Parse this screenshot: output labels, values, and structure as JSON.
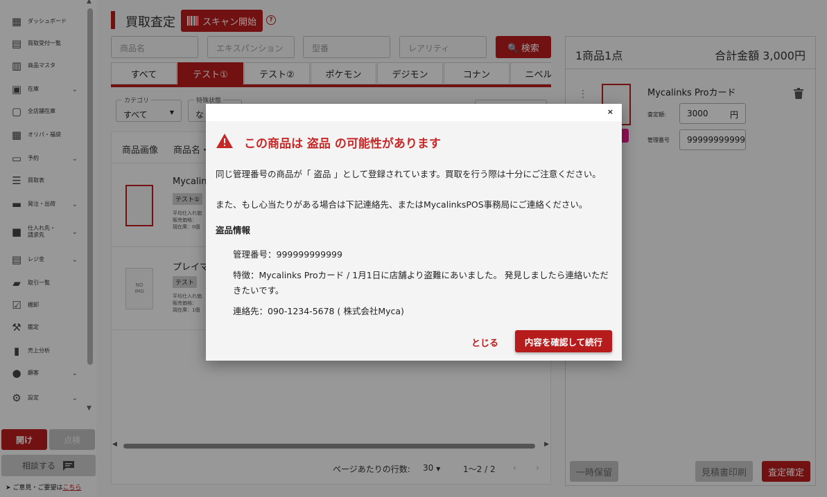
{
  "sidebar": {
    "items": [
      {
        "label": "ダッシュボード",
        "icon": "dashboard-icon",
        "has_children": false
      },
      {
        "label": "買取受付一覧",
        "icon": "receipt-icon",
        "has_children": false
      },
      {
        "label": "商品マスタ",
        "icon": "store-icon",
        "has_children": false
      },
      {
        "label": "在庫",
        "icon": "inventory-icon",
        "has_children": true
      },
      {
        "label": "全店舗在庫",
        "icon": "archive-icon",
        "has_children": false
      },
      {
        "label": "オリパ・福袋",
        "icon": "gift-icon",
        "has_children": false
      },
      {
        "label": "予約",
        "icon": "reserve-icon",
        "has_children": true
      },
      {
        "label": "買取表",
        "icon": "list-icon",
        "has_children": false
      },
      {
        "label": "発注・出荷",
        "icon": "truck-icon",
        "has_children": true
      },
      {
        "label": "仕入れ先・\n請求先",
        "icon": "factory-icon",
        "has_children": true
      },
      {
        "label": "レジ金",
        "icon": "register-icon",
        "has_children": true
      },
      {
        "label": "取引一覧",
        "icon": "folder-icon",
        "has_children": false
      },
      {
        "label": "棚卸",
        "icon": "checkbox-icon",
        "has_children": false
      },
      {
        "label": "鑑定",
        "icon": "gavel-icon",
        "has_children": false
      },
      {
        "label": "売上分析",
        "icon": "chart-icon",
        "has_children": false
      },
      {
        "label": "顧客",
        "icon": "people-icon",
        "has_children": true
      },
      {
        "label": "設定",
        "icon": "gear-icon",
        "has_children": true
      }
    ],
    "open_label": "開け",
    "check_label": "点検",
    "consult_label": "相談する",
    "feedback_text": "ご意見・ご要望は",
    "feedback_link": "こちら"
  },
  "header": {
    "title": "買取査定",
    "scan_label": "スキャン開始",
    "help": "?"
  },
  "search": {
    "name_placeholder": "商品名",
    "expansion_placeholder": "エキスパンション",
    "model_placeholder": "型番",
    "rarity_placeholder": "レアリティ",
    "button_label": "検索"
  },
  "tabs": [
    {
      "label": "すべて",
      "active": false
    },
    {
      "label": "テスト①",
      "active": true
    },
    {
      "label": "テスト②",
      "active": false
    },
    {
      "label": "ポケモン",
      "active": false
    },
    {
      "label": "デジモン",
      "active": false
    },
    {
      "label": "コナン",
      "active": false
    },
    {
      "label": "ニベルア",
      "active": false
    }
  ],
  "filters": {
    "category_label": "カテゴリ",
    "category_value": "すべて",
    "status_label": "特殊状態",
    "status_value": "な"
  },
  "table": {
    "headers": [
      "商品画像",
      "商品名・"
    ],
    "rows": [
      {
        "name": "Mycalinks",
        "chip": "テスト①",
        "info": [
          "平均仕入れ価",
          "販売価格：",
          "現在庫：0個"
        ]
      },
      {
        "name": "プレイマ",
        "chip": "テスト",
        "info": [
          "平均仕入れ価",
          "販売価格：",
          "現在庫：1個"
        ],
        "noimg": "NO\nIMG"
      }
    ]
  },
  "pager": {
    "rows_label": "ページあたりの行数:",
    "rows_value": "30",
    "range": "1〜2 / 2"
  },
  "cart": {
    "count": "1商品1点",
    "total": "合計金額 3,000円",
    "item_name": "Mycalinks Proカード",
    "price_label": "査定額:",
    "price_value": "3000",
    "price_unit": "円",
    "mgmt_label": "管理番号",
    "mgmt_value": "999999999999",
    "hold_label": "一時保留",
    "print_label": "見積書印刷",
    "confirm_label": "査定確定"
  },
  "modal": {
    "close_x": "×",
    "title": "この商品は 盗品 の可能性があります",
    "line1": "同じ管理番号の商品が「 盗品 」として登録されています。買取を行う際は十分にご注意ください。",
    "line2": "また、もし心当たりがある場合は下記連絡先、またはMycalinksPOS事務局にご連絡ください。",
    "section": "盗品情報",
    "mgmt": "管理番号：999999999999",
    "feature_1": "特徴：Mycalinks Proカード / 1月1日に店舗より盗難にあいました。 発見しましたら連絡いただ",
    "feature_2": "きたいです。",
    "contact": "連絡先：090-1234-5678 ( 株式会社Myca)",
    "close_btn": "とじる",
    "ok_btn": "内容を確認して続行"
  },
  "colors": {
    "accent": "#b71c1c",
    "warning": "#c62828"
  }
}
